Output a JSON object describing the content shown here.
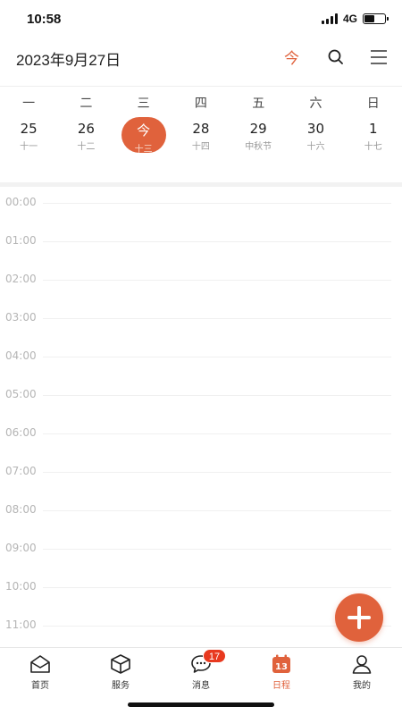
{
  "status_bar": {
    "time": "10:58",
    "network": "4G",
    "battery_level": 0.5
  },
  "header": {
    "date_title": "2023年9月27日",
    "today_label": "今"
  },
  "week": {
    "weekdays": [
      "一",
      "二",
      "三",
      "四",
      "五",
      "六",
      "日"
    ],
    "days": [
      {
        "num": "25",
        "lunar": "十一",
        "today": false
      },
      {
        "num": "26",
        "lunar": "十二",
        "today": false
      },
      {
        "num": "今",
        "lunar": "十三",
        "today": true
      },
      {
        "num": "28",
        "lunar": "十四",
        "today": false
      },
      {
        "num": "29",
        "lunar": "中秋节",
        "today": false
      },
      {
        "num": "30",
        "lunar": "十六",
        "today": false
      },
      {
        "num": "1",
        "lunar": "十七",
        "today": false
      }
    ]
  },
  "timeline": {
    "hours": [
      "00:00",
      "01:00",
      "02:00",
      "03:00",
      "04:00",
      "05:00",
      "06:00",
      "07:00",
      "08:00",
      "09:00",
      "10:00",
      "11:00"
    ]
  },
  "tabs": [
    {
      "label": "首页",
      "icon": "mail-open-icon",
      "active": false
    },
    {
      "label": "服务",
      "icon": "box-icon",
      "active": false
    },
    {
      "label": "消息",
      "icon": "chat-bubble-icon",
      "active": false,
      "badge": "17"
    },
    {
      "label": "日程",
      "icon": "calendar-icon",
      "active": true,
      "calendar_day": "13"
    },
    {
      "label": "我的",
      "icon": "person-icon",
      "active": false
    }
  ],
  "colors": {
    "accent": "#e0623c",
    "badge": "#e8391f"
  }
}
